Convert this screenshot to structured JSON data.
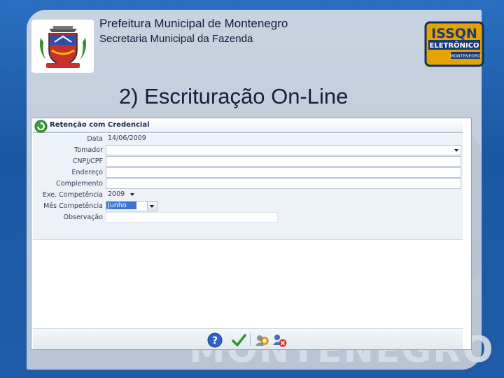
{
  "header": {
    "org_title": "Prefeitura Municipal de Montenegro",
    "org_subtitle": "Secretaria Municipal da Fazenda",
    "slide_title": "2) Escrituração On-Line",
    "brand_text": "ISSQN",
    "brand_subtext": "ELETRÔNICO",
    "brand_tag": "MONTENEGRO",
    "watermark_text": "MONTENEGRO"
  },
  "form": {
    "title": "Retenção com Credencial",
    "fields": {
      "data": {
        "label": "Data",
        "value": "14/06/2009"
      },
      "tomador": {
        "label": "Tomador",
        "value": ""
      },
      "cnpj": {
        "label": "CNPJ/CPF",
        "value": ""
      },
      "endereco": {
        "label": "Endereço",
        "value": ""
      },
      "complemento": {
        "label": "Complemento",
        "value": ""
      },
      "exe_competencia": {
        "label": "Exe. Competência",
        "value": "2009"
      },
      "mes_competencia": {
        "label": "Mês Competência",
        "value": "Junho"
      },
      "observacao": {
        "label": "Observação",
        "value": ""
      }
    },
    "toolbar": [
      "help-icon",
      "confirm-check-icon",
      "search-people-icon",
      "clear-people-icon"
    ]
  },
  "colors": {
    "background": "#1f5fa8",
    "panel": "#c3cddb",
    "selection": "#3b74d4",
    "title_text": "#151f3d"
  }
}
